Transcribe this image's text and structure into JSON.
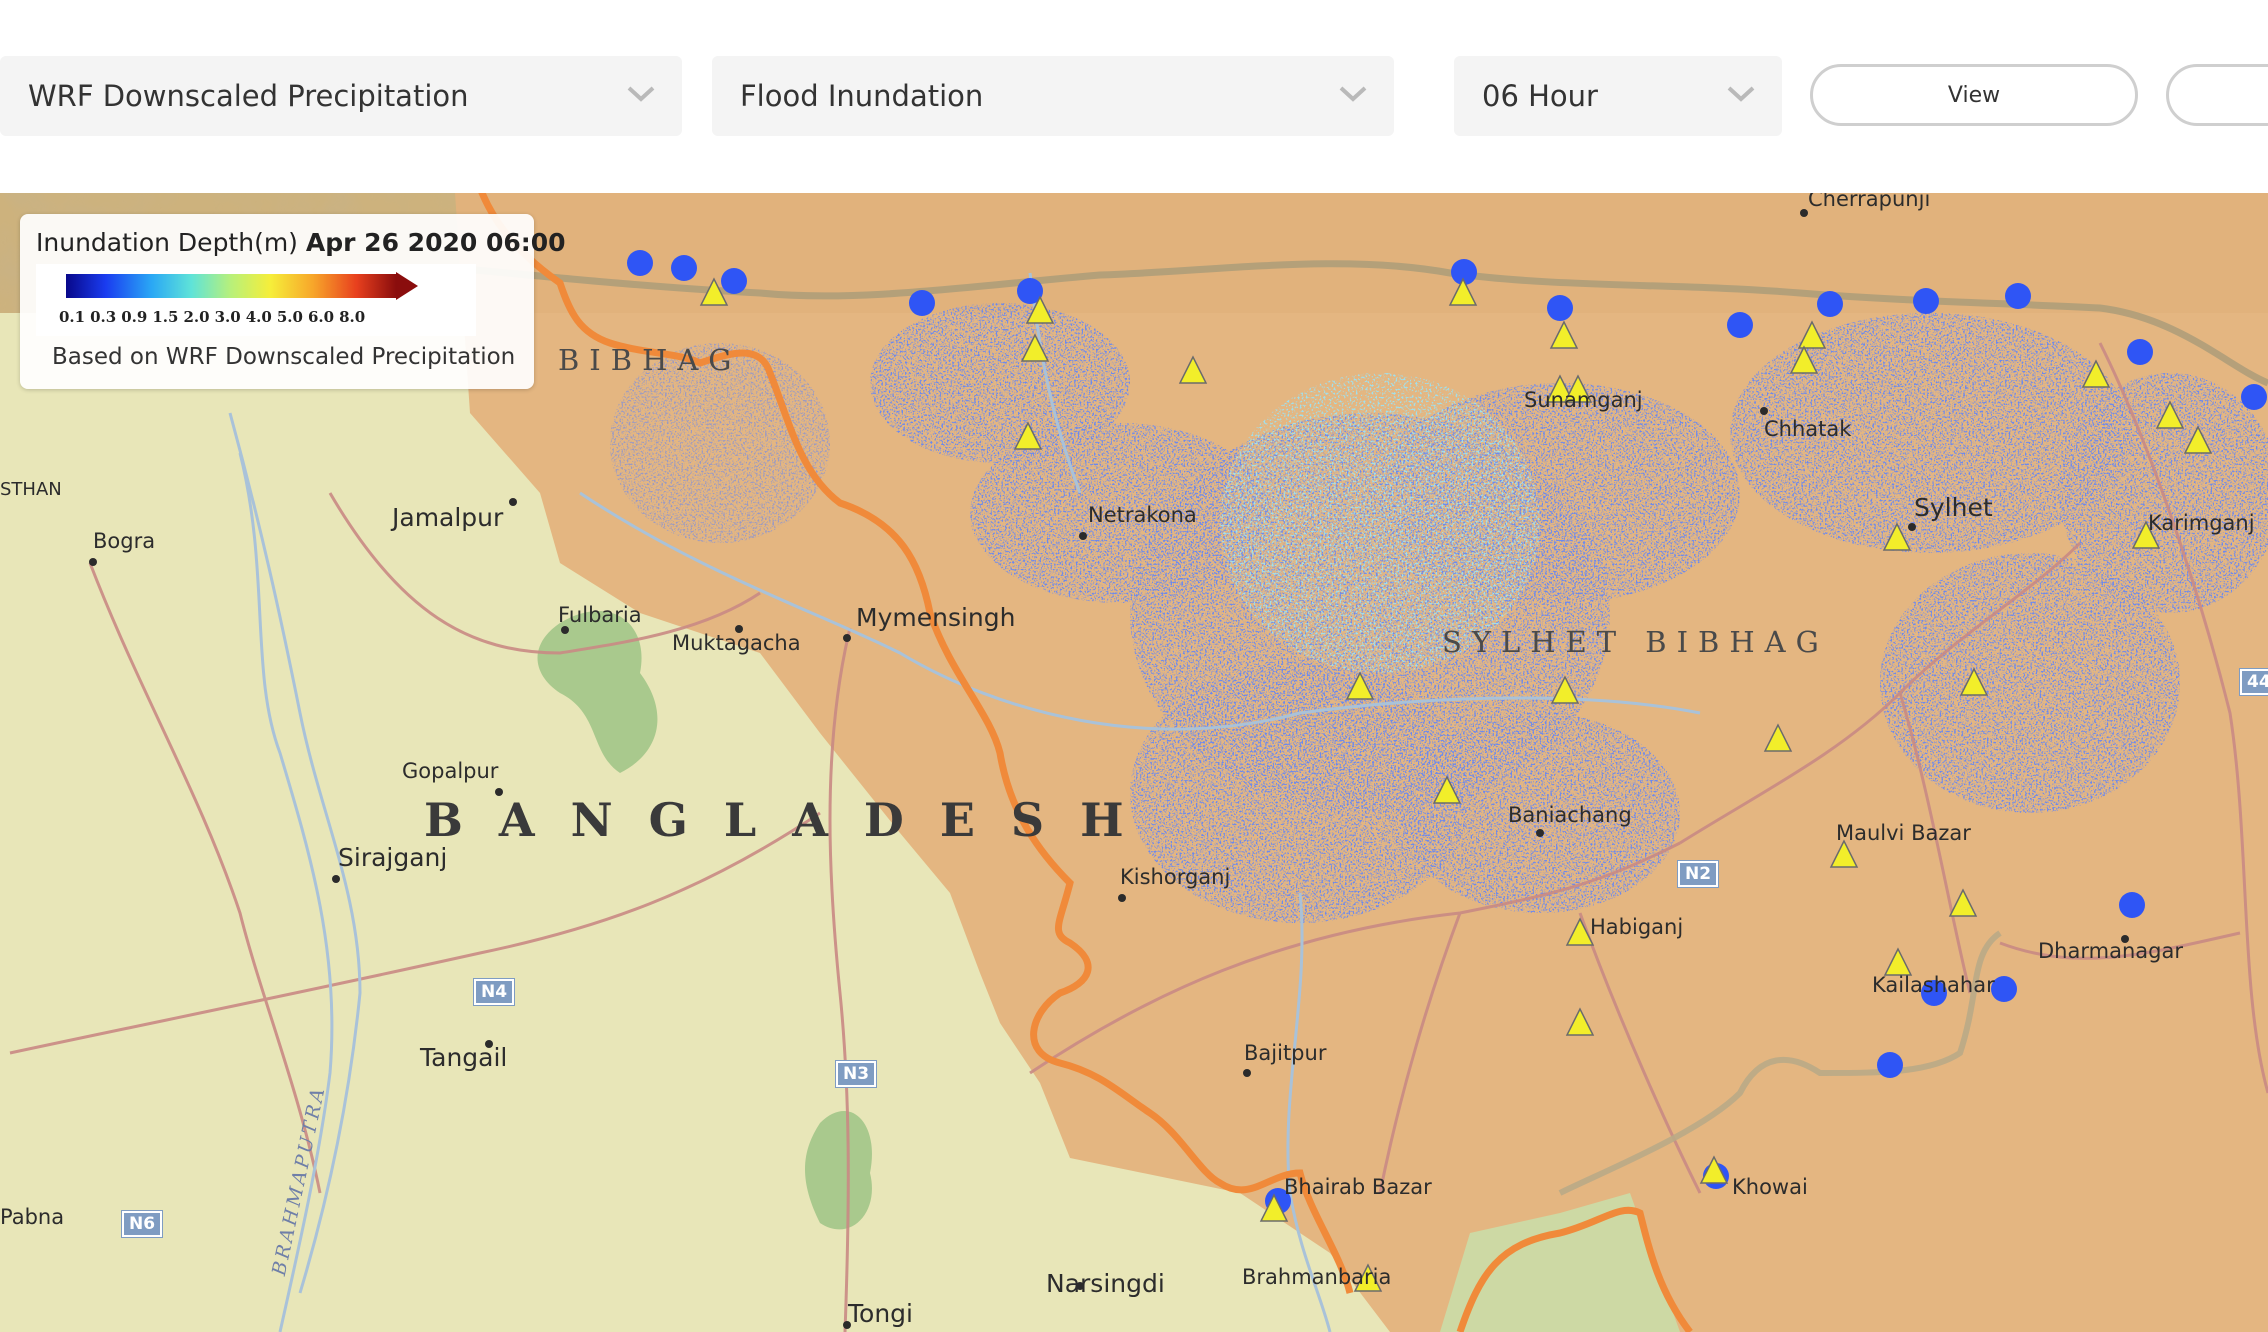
{
  "toolbar": {
    "precipitation_select": "WRF Downscaled Precipitation",
    "product_select": "Flood Inundation",
    "timestep_select": "06 Hour",
    "view_button": "View"
  },
  "legend": {
    "title_prefix": "Inundation Depth(m)",
    "title_date": "Apr 26 2020 06:00",
    "ticks": [
      "0.1",
      "0.3",
      "0.9",
      "1.5",
      "2.0",
      "3.0",
      "4.0",
      "5.0",
      "6.0",
      "8.0"
    ],
    "note": "Based on WRF Downscaled Precipitation"
  },
  "map": {
    "country_label": "BANGLADESH",
    "region_labels": [
      "SYLHET BIBHAG",
      "BIBHAG"
    ],
    "edge_labels": [
      "STHAN",
      "Cherrapunji",
      "Karimganj"
    ],
    "river_label": "BRAHMAPUTRA",
    "places": [
      "Sunamganj",
      "Chhatak",
      "Sylhet",
      "Netrakona",
      "Mymensingh",
      "Muktagacha",
      "Fulbaria",
      "Jamalpur",
      "Bogra",
      "Gopalpur",
      "Sirajganj",
      "Tangail",
      "Pabna",
      "Kishorganj",
      "Baniachang",
      "Maulvi Bazar",
      "Habiganj",
      "Bajitpur",
      "Kailashahar",
      "Dharmanagar",
      "Khowai",
      "Bhairab Bazar",
      "Brahmanbaria",
      "Narsingdi",
      "Tongi"
    ],
    "road_shields": [
      "N4",
      "N3",
      "N6",
      "N2",
      "44"
    ],
    "colors": {
      "base_land": "#e8e6b8",
      "basin_overlay": "#e3b27c",
      "boundary": "#f08a3a",
      "station_circle": "#2f55f5",
      "station_triangle": "#f2ee2a"
    }
  }
}
